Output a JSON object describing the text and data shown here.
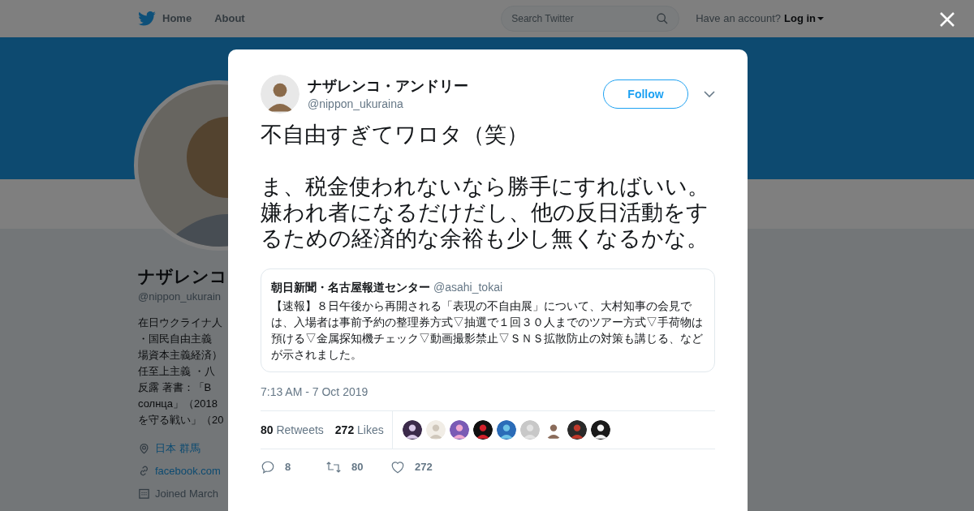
{
  "header": {
    "nav": [
      {
        "label": "Home"
      },
      {
        "label": "About"
      }
    ],
    "search": {
      "placeholder": "Search Twitter"
    },
    "account_prompt": "Have an account?",
    "login": "Log in"
  },
  "profile": {
    "name": "ナザレンコ",
    "handle": "@nippon_ukurain",
    "bio_lines": [
      "在日ウクライナ人",
      "・国民自由主義",
      "場資本主義経済）",
      "任至上主義 ・八",
      "反露 著書：「В",
      "солнца」（2018",
      "を守る戦い」（20"
    ],
    "location": "日本 群馬",
    "link": "facebook.com",
    "joined": "Joined March"
  },
  "tweet": {
    "author": "ナザレンコ・アンドリー",
    "handle": "@nippon_ukuraina",
    "follow": "Follow",
    "paragraphs": [
      "不自由すぎてワロタ（笑）",
      "ま、税金使われないなら勝手にすればいい。嫌われ者になるだけだし、他の反日活動をするための経済的な余裕も少し無くなるかな。"
    ],
    "quote": {
      "author": "朝日新聞・名古屋報道センター",
      "handle": "@asahi_tokai",
      "text": "【速報】８日午後から再開される「表現の不自由展」について、大村知事の会見では、入場者は事前予約の整理券方式▽抽選で１回３０人までのツアー方式▽手荷物は預ける▽金属探知機チェック▽動画撮影禁止▽ＳＮＳ拡散防止の対策も講じる、などが示されました。"
    },
    "time": "7:13 AM - 7 Oct 2019",
    "stats": [
      {
        "count": "80",
        "label": "Retweets"
      },
      {
        "count": "272",
        "label": "Likes"
      }
    ],
    "likers": [
      {
        "kind": "picture"
      },
      {
        "kind": "picture"
      },
      {
        "kind": "picture"
      },
      {
        "kind": "picture"
      },
      {
        "kind": "picture"
      },
      {
        "kind": "picture"
      },
      {
        "kind": "picture"
      },
      {
        "kind": "picture"
      },
      {
        "kind": "picture"
      }
    ],
    "actions": [
      {
        "kind": "reply",
        "count": "8"
      },
      {
        "kind": "retweet",
        "count": "80"
      },
      {
        "kind": "like",
        "count": "272"
      }
    ]
  }
}
